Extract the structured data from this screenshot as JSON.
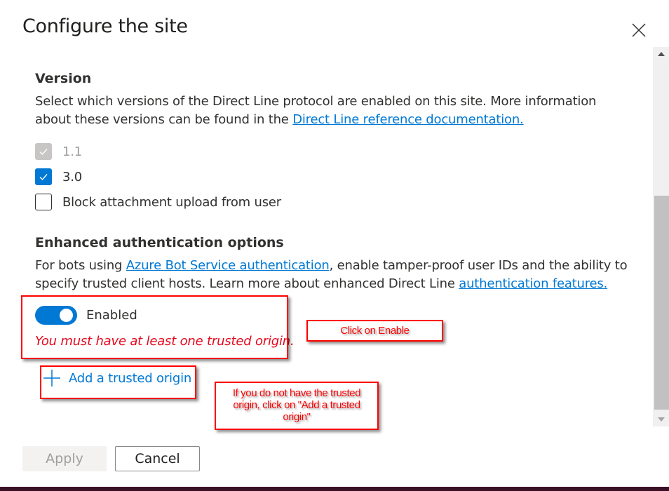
{
  "dialog": {
    "title": "Configure the site",
    "close_icon": "close-icon"
  },
  "version": {
    "heading": "Version",
    "description_line1": "Select which versions of the Direct Line protocol are enabled on this site. More information",
    "description_line2_prefix": "about these versions can be found in the ",
    "description_link": "Direct Line reference documentation.",
    "options": [
      {
        "label": "1.1",
        "checked": true,
        "disabled": true
      },
      {
        "label": "3.0",
        "checked": true,
        "disabled": false
      },
      {
        "label": "Block attachment upload from user",
        "checked": false,
        "disabled": false
      }
    ]
  },
  "enhanced_auth": {
    "heading": "Enhanced authentication options",
    "desc_prefix": "For bots using ",
    "desc_link1": "Azure Bot Service authentication",
    "desc_middle": ", enable tamper-proof user IDs and the ability to",
    "desc_line2_prefix": "specify trusted client hosts. Learn more about enhanced Direct Line ",
    "desc_link2": "authentication features.",
    "toggle_label": "Enabled",
    "toggle_on": true,
    "error_message": "You must have at least one trusted origin.",
    "add_origin_label": "Add a trusted origin"
  },
  "annotations": {
    "click_enable": "Click on Enable",
    "add_origin_hint_line1": "If you do not have the trusted",
    "add_origin_hint_line2": "origin, click on \"Add a trusted",
    "add_origin_hint_line3": "origin\""
  },
  "footer": {
    "apply_label": "Apply",
    "cancel_label": "Cancel"
  },
  "colors": {
    "accent": "#0078d4",
    "error": "#e5081e",
    "annotation": "#ff0000"
  }
}
